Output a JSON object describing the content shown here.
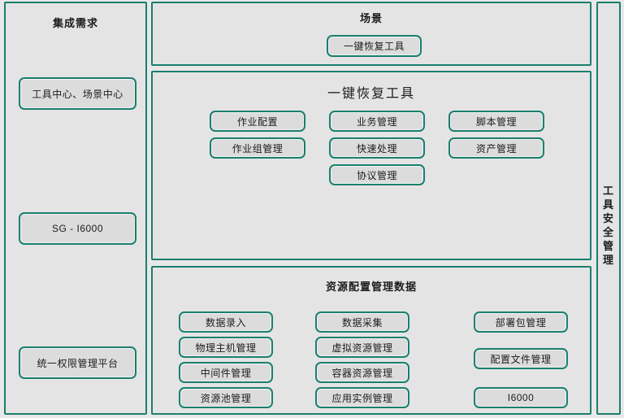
{
  "left_sidebar": {
    "title": "集成需求",
    "nodes": [
      {
        "label": "工具中心、场景中心"
      },
      {
        "label": "SG - I6000"
      },
      {
        "label": "统一权限管理平台"
      }
    ]
  },
  "right_sidebar": {
    "title": "工具安全管理",
    "characters": [
      "工",
      "具",
      "安",
      "全",
      "管",
      "理"
    ]
  },
  "scene_panel": {
    "title": "场景",
    "nodes": [
      {
        "label": "一键恢复工具"
      }
    ]
  },
  "tool_panel": {
    "title": "一键恢复工具",
    "columns": [
      {
        "nodes": [
          {
            "label": "作业配置"
          },
          {
            "label": "作业组管理"
          }
        ]
      },
      {
        "nodes": [
          {
            "label": "业务管理"
          },
          {
            "label": "快速处理"
          },
          {
            "label": "协议管理"
          }
        ]
      },
      {
        "nodes": [
          {
            "label": "脚本管理"
          },
          {
            "label": "资产管理"
          }
        ]
      }
    ]
  },
  "resource_panel": {
    "title": "资源配置管理数据",
    "columns": [
      {
        "nodes": [
          {
            "label": "数据录入"
          },
          {
            "label": "物理主机管理"
          },
          {
            "label": "中间件管理"
          },
          {
            "label": "资源池管理"
          }
        ]
      },
      {
        "nodes": [
          {
            "label": "数据采集"
          },
          {
            "label": "虚拟资源管理"
          },
          {
            "label": "容器资源管理"
          },
          {
            "label": "应用实例管理"
          }
        ]
      },
      {
        "nodes": [
          {
            "label": "部署包管理"
          },
          {
            "label": "配置文件管理"
          },
          {
            "label": "I6000"
          }
        ]
      }
    ]
  },
  "colors": {
    "border": "#1a7f6e",
    "panel_background": "#e4e4e4",
    "node_background": "#dcdcdc",
    "page_background": "#e8e8e8",
    "text": "#1c1c1c"
  }
}
